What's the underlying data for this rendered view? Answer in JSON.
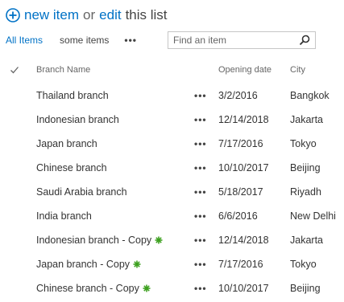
{
  "command_bar": {
    "new_item": "new item",
    "or": "or",
    "edit": "edit",
    "this_list": "this list"
  },
  "views": {
    "all_items": "All Items",
    "some_items": "some items",
    "more": "•••"
  },
  "search": {
    "placeholder": "Find an item"
  },
  "columns": {
    "title": "Branch Name",
    "date": "Opening date",
    "city": "City"
  },
  "rows": [
    {
      "title": "Thailand branch",
      "date": "3/2/2016",
      "city": "Bangkok",
      "is_new": false
    },
    {
      "title": "Indonesian branch",
      "date": "12/14/2018",
      "city": "Jakarta",
      "is_new": false
    },
    {
      "title": "Japan branch",
      "date": "7/17/2016",
      "city": "Tokyo",
      "is_new": false
    },
    {
      "title": "Chinese branch",
      "date": "10/10/2017",
      "city": "Beijing",
      "is_new": false
    },
    {
      "title": "Saudi Arabia branch",
      "date": "5/18/2017",
      "city": "Riyadh",
      "is_new": false
    },
    {
      "title": "India branch",
      "date": "6/6/2016",
      "city": "New Delhi",
      "is_new": false
    },
    {
      "title": "Indonesian branch - Copy",
      "date": "12/14/2018",
      "city": "Jakarta",
      "is_new": true
    },
    {
      "title": "Japan branch - Copy",
      "date": "7/17/2016",
      "city": "Tokyo",
      "is_new": true
    },
    {
      "title": "Chinese branch - Copy",
      "date": "10/10/2017",
      "city": "Beijing",
      "is_new": true
    }
  ],
  "row_menu": "•••",
  "colors": {
    "accent": "#0072c6",
    "new_badge": "#3ca01e"
  }
}
